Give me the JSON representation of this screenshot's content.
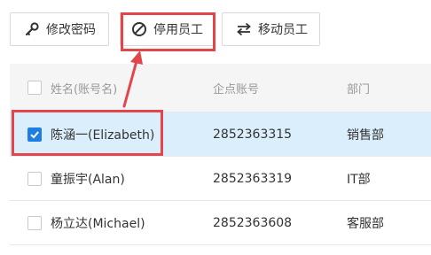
{
  "toolbar": {
    "change_password": {
      "label": "修改密码",
      "icon": "key-icon"
    },
    "disable_employee": {
      "label": "停用员工",
      "icon": "ban-icon"
    },
    "move_employee": {
      "label": "移动员工",
      "icon": "swap-arrows-icon"
    }
  },
  "annotation": {
    "color": "#e2464a"
  },
  "accent": "#1f7fe0",
  "table": {
    "headers": {
      "name": "姓名(账号名)",
      "account": "企点账号",
      "department": "部门"
    },
    "rows": [
      {
        "name": "陈涵一(Elizabeth)",
        "account": "2852363315",
        "department": "销售部",
        "checked": true
      },
      {
        "name": "童振宇(Alan)",
        "account": "2852363319",
        "department": "IT部",
        "checked": false
      },
      {
        "name": "杨立达(Michael)",
        "account": "2852363608",
        "department": "客服部",
        "checked": false
      }
    ]
  }
}
